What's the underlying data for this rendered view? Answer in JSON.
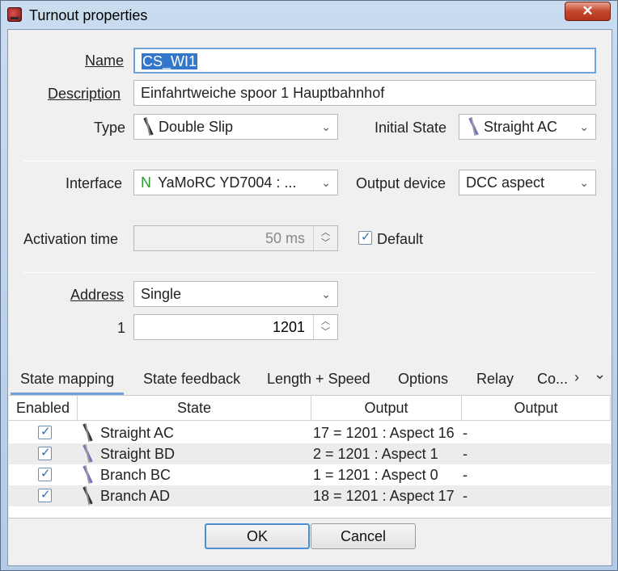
{
  "window": {
    "title": "Turnout properties",
    "close_glyph": "✕"
  },
  "form": {
    "name_label": "Name",
    "name_value": "CS_WI1",
    "description_label": "Description",
    "description_value": "Einfahrtweiche spoor 1 Hauptbahnhof",
    "type_label": "Type",
    "type_value": "Double Slip",
    "initial_state_label": "Initial State",
    "initial_state_value": "Straight AC",
    "interface_label": "Interface",
    "interface_badge": "N",
    "interface_value": "YaMoRC YD7004 : ...",
    "output_device_label": "Output device",
    "output_device_value": "DCC aspect",
    "activation_time_label": "Activation time",
    "activation_time_value": "50 ms",
    "default_label": "Default",
    "default_checked": true,
    "address_label": "Address",
    "address_value": "Single",
    "address_index_label": "1",
    "address_index_value": "1201"
  },
  "tabs": [
    {
      "label": "State mapping",
      "active": true
    },
    {
      "label": "State feedback"
    },
    {
      "label": "Length + Speed"
    },
    {
      "label": "Options"
    },
    {
      "label": "Relay"
    },
    {
      "label": "Co..."
    }
  ],
  "tab_nav": {
    "next_glyph": "›",
    "menu_glyph": "⌄"
  },
  "table": {
    "columns": [
      "Enabled",
      "State",
      "Output",
      "Output"
    ],
    "rows": [
      {
        "enabled": true,
        "state": "Straight AC",
        "output1": "17 = 1201 : Aspect 16",
        "output2": "-"
      },
      {
        "enabled": true,
        "state": "Straight BD",
        "output1": "2 = 1201 : Aspect 1",
        "output2": "-"
      },
      {
        "enabled": true,
        "state": "Branch BC",
        "output1": "1 = 1201 : Aspect 0",
        "output2": "-"
      },
      {
        "enabled": true,
        "state": "Branch AD",
        "output1": "18 = 1201 : Aspect 17",
        "output2": "-"
      }
    ]
  },
  "buttons": {
    "ok": "OK",
    "cancel": "Cancel"
  },
  "colors": {
    "accent": "#6fa3d8",
    "selection": "#3377cc",
    "close": "#c4472e"
  }
}
